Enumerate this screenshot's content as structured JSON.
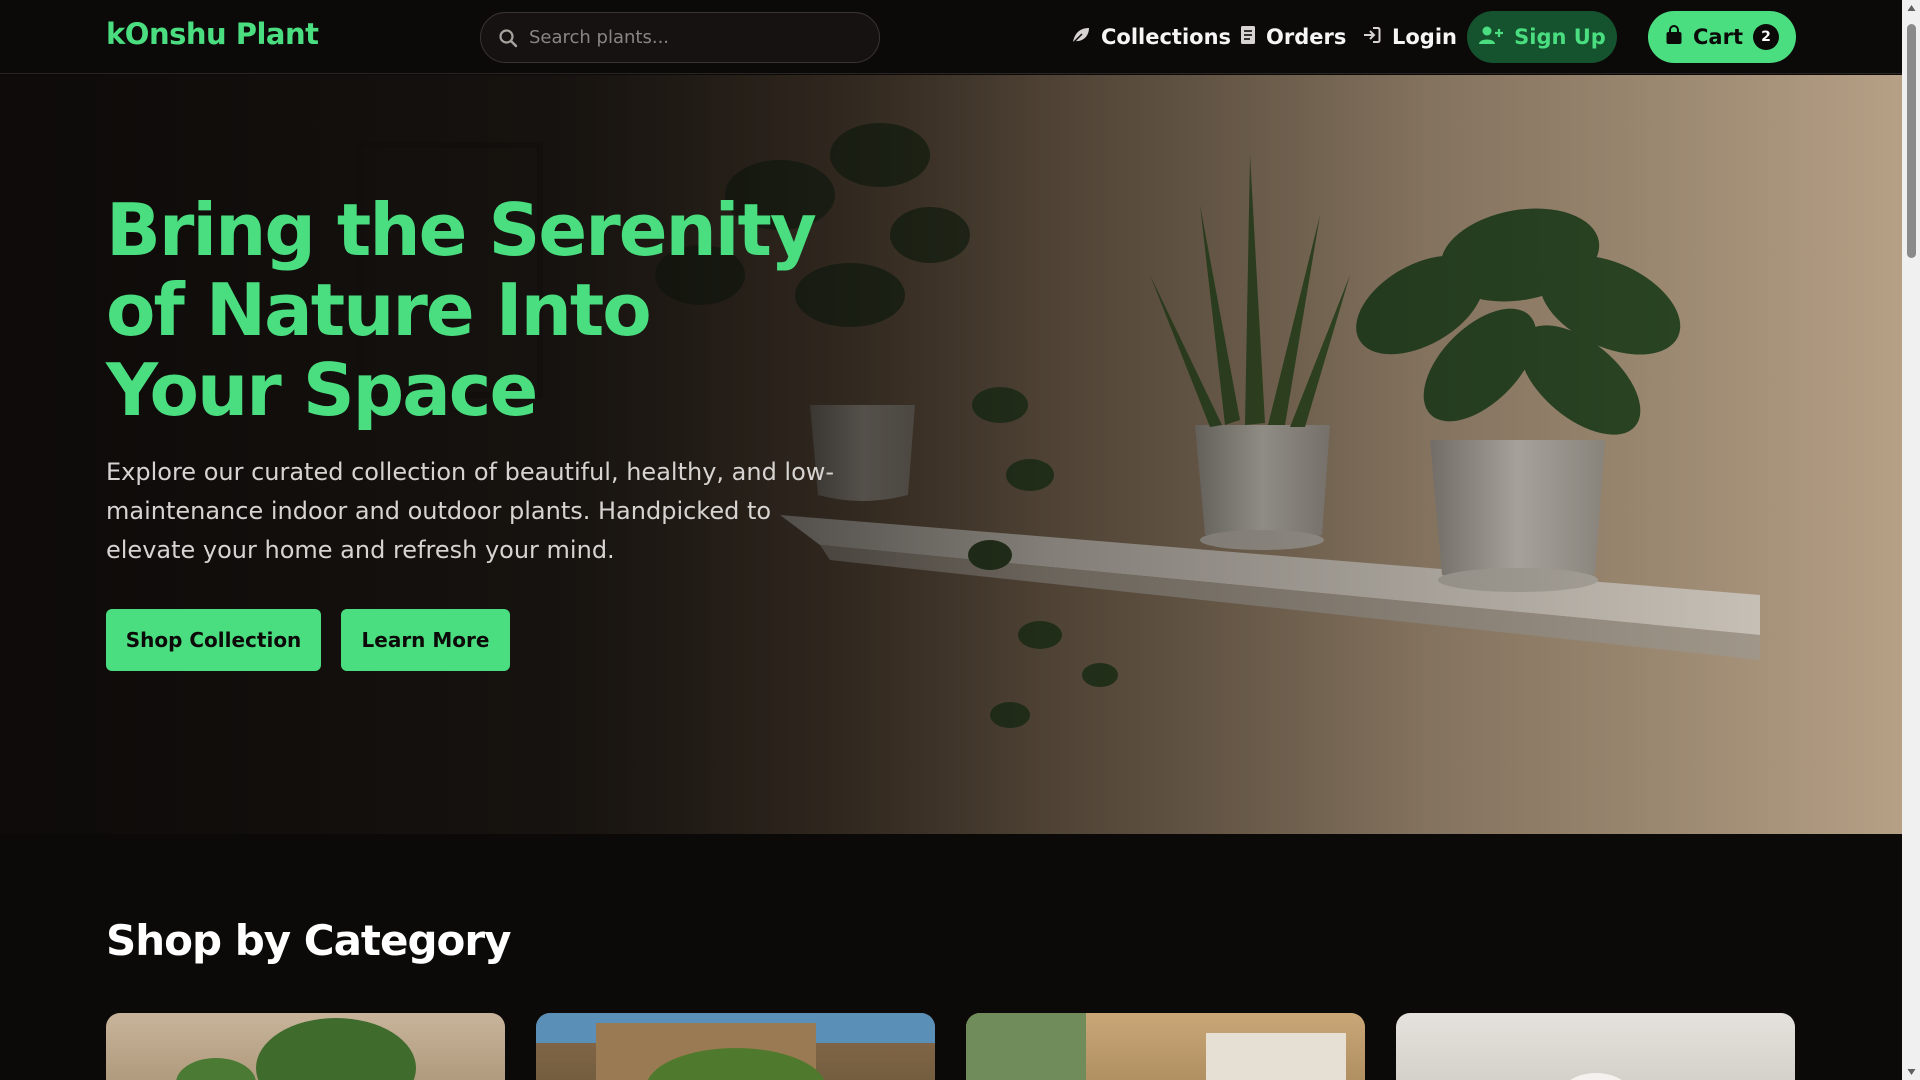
{
  "navbar": {
    "brand": "kOnshu Plant",
    "search": {
      "placeholder": "Search plants...",
      "value": ""
    },
    "links": {
      "collections": "Collections",
      "orders": "Orders",
      "login": "Login"
    },
    "signup_label": "Sign Up",
    "cart": {
      "label": "Cart",
      "count": "2"
    }
  },
  "hero": {
    "title": "Bring the Serenity of Nature Into Your Space",
    "description": "Explore our curated collection of beautiful, healthy, and low-maintenance indoor and outdoor plants. Handpicked to elevate your home and refresh your mind.",
    "primary_button": "Shop Collection",
    "secondary_button": "Learn More"
  },
  "categories": {
    "title": "Shop by Category"
  },
  "colors": {
    "accent": "#4ade80",
    "background": "#0c0a09",
    "signup_bg": "#14532d"
  },
  "icons": {
    "search": "search-icon",
    "collections": "leaf-icon",
    "orders": "receipt-icon",
    "login": "login-icon",
    "signup": "user-plus-icon",
    "cart": "shopping-bag-icon"
  }
}
